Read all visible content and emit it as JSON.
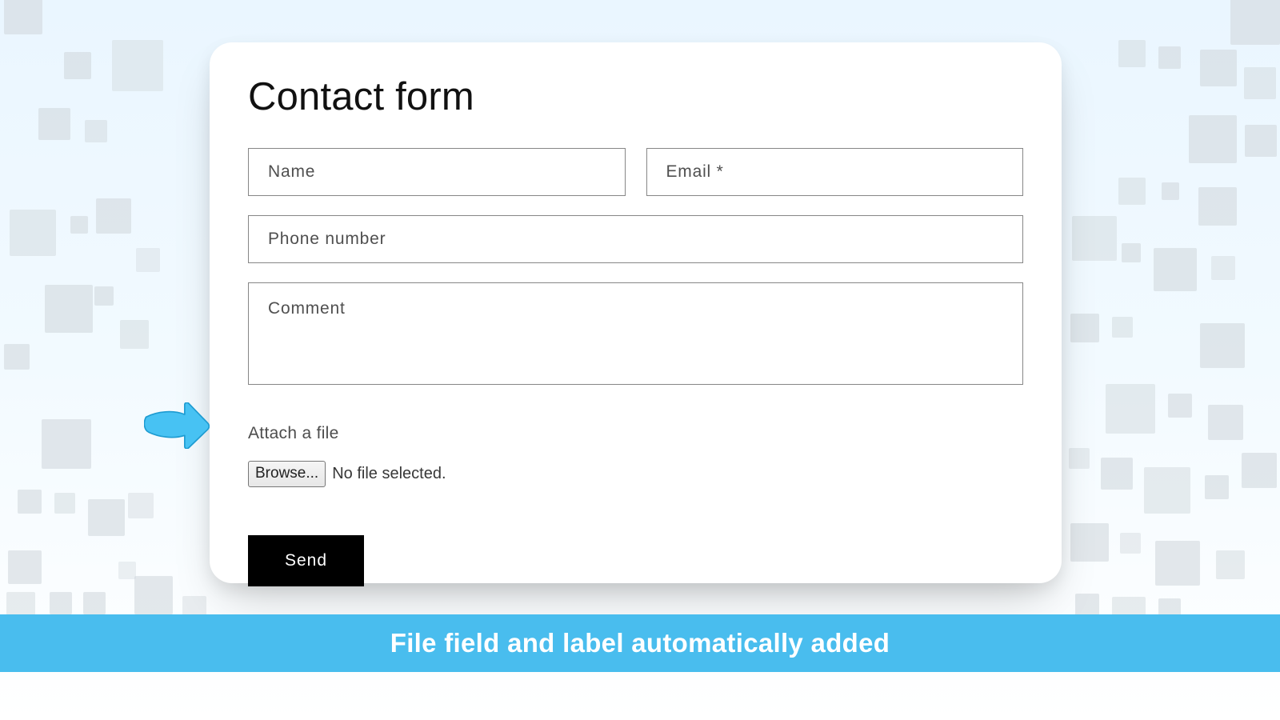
{
  "form": {
    "title": "Contact form",
    "name_placeholder": "Name",
    "email_placeholder": "Email *",
    "phone_placeholder": "Phone number",
    "comment_placeholder": "Comment",
    "attach_label": "Attach a file",
    "browse_label": "Browse...",
    "file_status": "No file selected.",
    "submit_label": "Send"
  },
  "banner": {
    "text": "File field and label automatically added"
  },
  "colors": {
    "accent": "#49bdee",
    "arrow": "#47c2f3"
  }
}
